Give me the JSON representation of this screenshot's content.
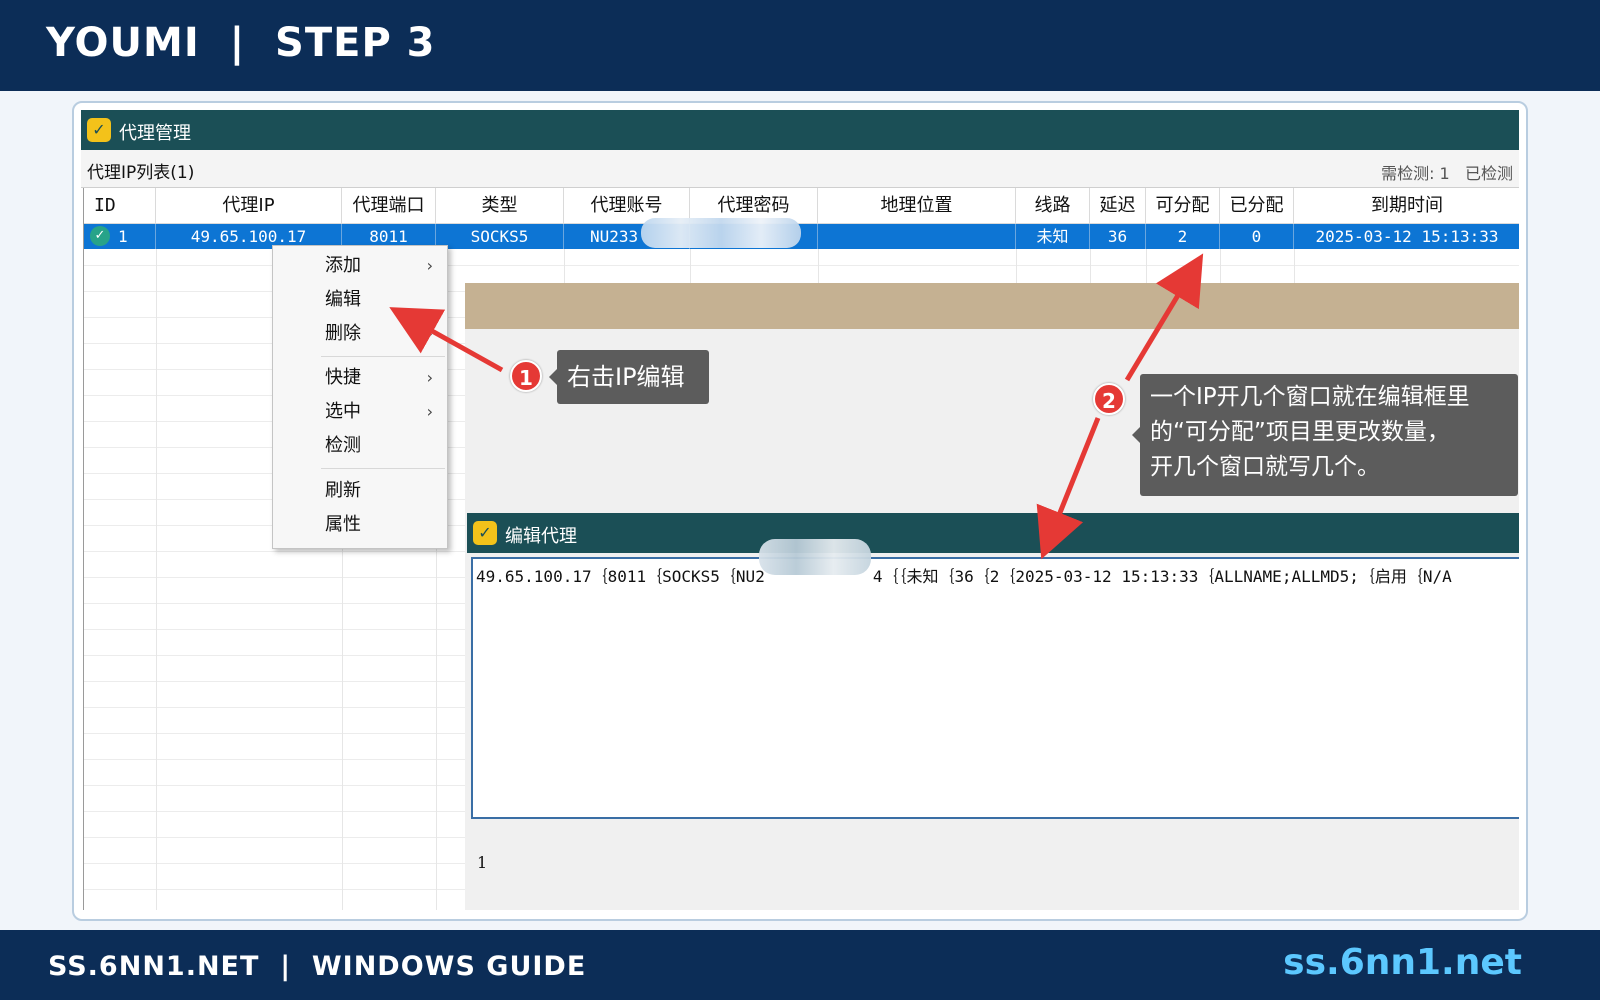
{
  "header": {
    "title": "YOUMI  |  STEP 3"
  },
  "footer": {
    "left": "SS.6NN1.NET  |  WINDOWS GUIDE",
    "right": "ss.6nn1.net"
  },
  "window": {
    "title": "代理管理",
    "list_title": "代理IP列表(1)",
    "status_right": "需检测: 1   已检测"
  },
  "table": {
    "columns": [
      "ID",
      "代理IP",
      "代理端口",
      "类型",
      "代理账号",
      "代理密码",
      "地理位置",
      "线路",
      "延迟",
      "可分配",
      "已分配",
      "到期时间"
    ],
    "row": {
      "id": "1",
      "ip": "49.65.100.17",
      "port": "8011",
      "type": "SOCKS5",
      "account": "NU233",
      "password": "",
      "location": "",
      "line": "未知",
      "delay": "36",
      "allocatable": "2",
      "allocated": "0",
      "expire": "2025-03-12 15:13:33"
    }
  },
  "context_menu": {
    "items": [
      {
        "label": "添加",
        "arrow": "›"
      },
      {
        "label": "编辑",
        "arrow": ""
      },
      {
        "label": "删除",
        "arrow": "›"
      },
      {
        "label": "快捷",
        "arrow": "›"
      },
      {
        "label": "选中",
        "arrow": "›"
      },
      {
        "label": "检测",
        "arrow": ""
      },
      {
        "label": "刷新",
        "arrow": ""
      },
      {
        "label": "属性",
        "arrow": ""
      }
    ]
  },
  "edit_dialog": {
    "title": "编辑代理",
    "text_part1": "49.65.100.17｛8011｛SOCKS5｛NU2",
    "text_part2": "4｛｛未知｛36｛2｛2025-03-12 15:13:33｛ALLNAME;ALLMD5;｛启用｛N/A",
    "footer_value": "1"
  },
  "annotations": {
    "badge1": "1",
    "callout1": "右击IP编辑",
    "badge2": "2",
    "callout2": [
      "一个IP开几个窗口就在编辑框里",
      "的“可分配”项目里更改数量，",
      "开几个窗口就写几个。"
    ]
  },
  "colors": {
    "header_bg": "#0c2d57",
    "title_bar": "#1b4f56",
    "selection": "#0d75d4",
    "arrow": "#e53935",
    "callout_bg": "#5c5c5c",
    "footer_link": "#5cc8ff"
  },
  "icons": {
    "app": "app-logo-icon",
    "status": "check-circle-icon"
  }
}
